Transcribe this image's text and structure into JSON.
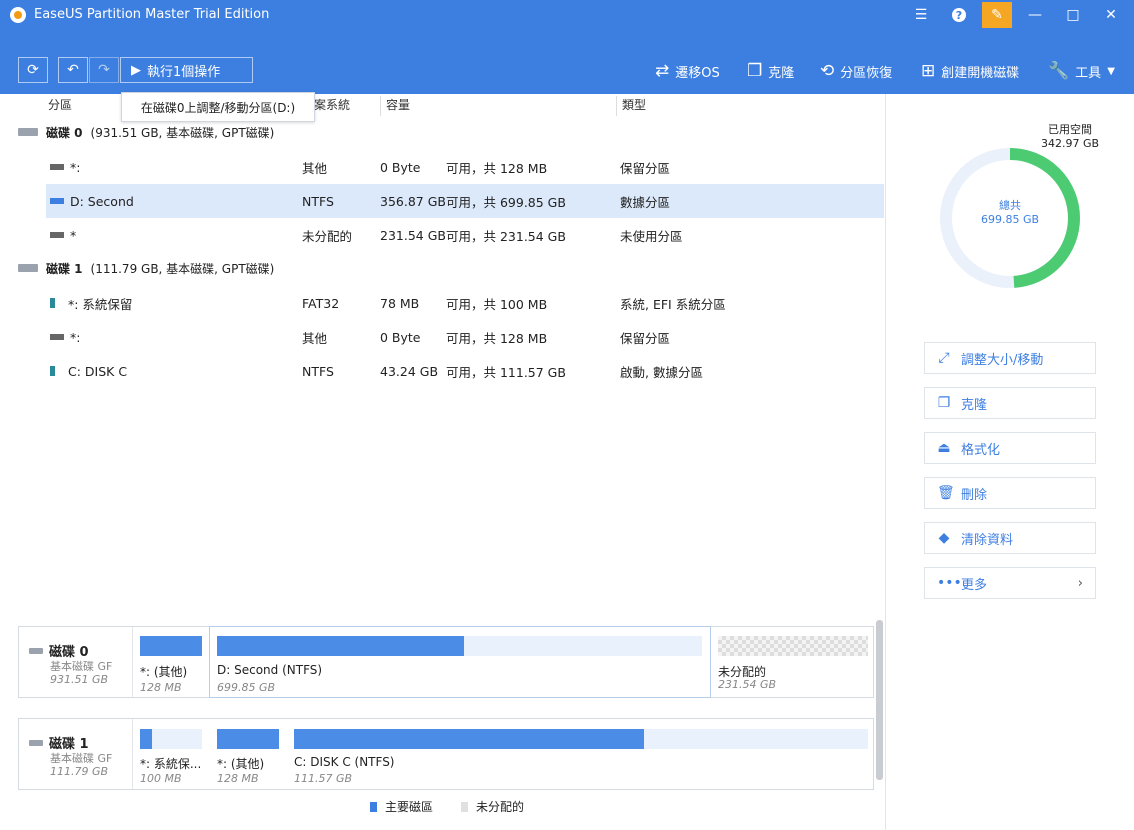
{
  "window": {
    "title": "EaseUS Partition Master Trial Edition",
    "accent_color": "#3d7fe0"
  },
  "toolbar": {
    "execute_label": "執行1個操作",
    "tools": [
      {
        "icon": "migrate-icon",
        "label": "遷移OS"
      },
      {
        "icon": "clone-icon",
        "label": "克隆"
      },
      {
        "icon": "recovery-icon",
        "label": "分區恢復"
      },
      {
        "icon": "windows-icon",
        "label": "創建開機磁碟"
      },
      {
        "icon": "wrench-icon",
        "label": "工具"
      }
    ]
  },
  "tooltip": "在磁碟0上調整/移動分區(D:)",
  "table": {
    "headers": {
      "partition": "分區",
      "filesystem": "檔案系統",
      "capacity": "容量",
      "type": "類型"
    },
    "disks": [
      {
        "label": "磁碟 0",
        "info": "(931.51 GB, 基本磁碟, GPT磁碟)"
      },
      {
        "label": "磁碟 1",
        "info": "(111.79 GB, 基本磁碟, GPT磁碟)"
      }
    ],
    "rows": [
      {
        "name": "*:",
        "fs": "其他",
        "used": "0 Byte",
        "free": "可用，共  128 MB",
        "type": "保留分區"
      },
      {
        "name": "D: Second",
        "fs": "NTFS",
        "used": "356.87 GB",
        "free": "可用，共  699.85 GB",
        "type": "數據分區"
      },
      {
        "name": "*",
        "fs": "未分配的",
        "used": "231.54 GB",
        "free": "可用，共  231.54 GB",
        "type": "未使用分區"
      },
      {
        "name": "*: 系統保留",
        "fs": "FAT32",
        "used": "78 MB",
        "free": "可用，共  100 MB",
        "type": "系統, EFI 系統分區"
      },
      {
        "name": "*:",
        "fs": "其他",
        "used": "0 Byte",
        "free": "可用，共  128 MB",
        "type": "保留分區"
      },
      {
        "name": "C: DISK C",
        "fs": "NTFS",
        "used": "43.24 GB",
        "free": "可用，共  111.57 GB",
        "type": "啟動, 數據分區"
      }
    ]
  },
  "usage": {
    "used_label": "已用空間",
    "used_value": "342.97 GB",
    "total_label": "總共",
    "total_value": "699.85 GB",
    "used_fraction": 0.49
  },
  "actions": [
    {
      "icon": "resize-icon",
      "label": "調整大小/移動"
    },
    {
      "icon": "clone-icon",
      "label": "克隆"
    },
    {
      "icon": "format-icon",
      "label": "格式化"
    },
    {
      "icon": "delete-icon",
      "label": "刪除"
    },
    {
      "icon": "eraser-icon",
      "label": "清除資料"
    },
    {
      "icon": "more-icon",
      "label": "更多"
    }
  ],
  "disk_map": [
    {
      "title": "磁碟 0",
      "type": "基本磁碟 GF",
      "size": "931.51 GB",
      "segments": [
        {
          "label": "*: (其他)",
          "size": "128 MB",
          "used_fraction": 1.0
        },
        {
          "label": "D: Second (NTFS)",
          "size": "699.85 GB",
          "used_fraction": 0.51
        },
        {
          "label": "未分配的",
          "size": "231.54 GB",
          "used_fraction": 0
        }
      ]
    },
    {
      "title": "磁碟 1",
      "type": "基本磁碟 GF",
      "size": "111.79 GB",
      "segments": [
        {
          "label": "*: 系統保...",
          "size": "100 MB",
          "used_fraction": 0.2
        },
        {
          "label": "*: (其他)",
          "size": "128 MB",
          "used_fraction": 1.0
        },
        {
          "label": "C: DISK C (NTFS)",
          "size": "111.57 GB",
          "used_fraction": 0.61
        }
      ]
    }
  ],
  "legend": {
    "primary": "主要磁區",
    "unallocated": "未分配的"
  }
}
